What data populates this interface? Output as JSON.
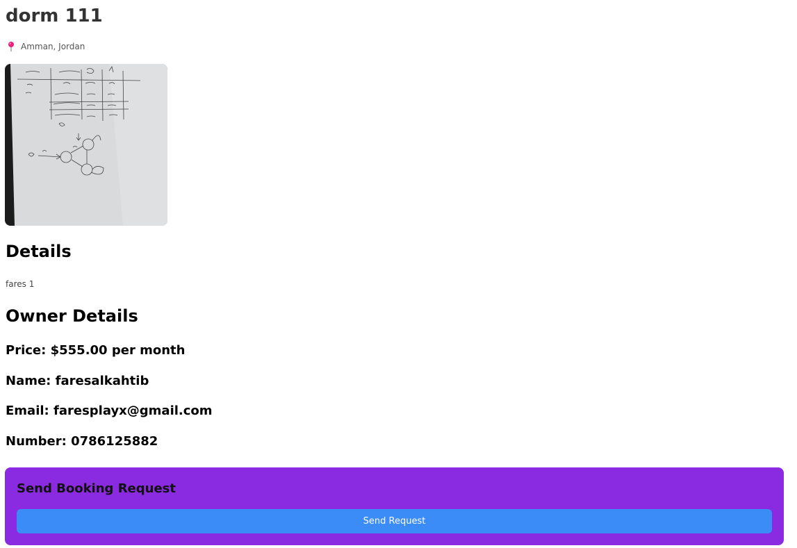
{
  "listing": {
    "title": "dorm 111",
    "location": "Amman, Jordan"
  },
  "details": {
    "heading": "Details",
    "text": "fares 1"
  },
  "owner": {
    "heading": "Owner Details",
    "price_label": "Price: ",
    "price_value": "$555.00 per month",
    "name_label": "Name: ",
    "name_value": "faresalkahtib",
    "email_label": "Email: ",
    "email_value": "faresplayx@gmail.com",
    "number_label": "Number: ",
    "number_value": "0786125882"
  },
  "booking": {
    "heading": "Send Booking Request",
    "button_label": "Send Request"
  },
  "icons": {
    "location": "map-pin-icon"
  },
  "colors": {
    "title": "#333333",
    "booking_panel": "#8a2be2",
    "button": "#3c8cf7",
    "pin": "#e8207a"
  }
}
